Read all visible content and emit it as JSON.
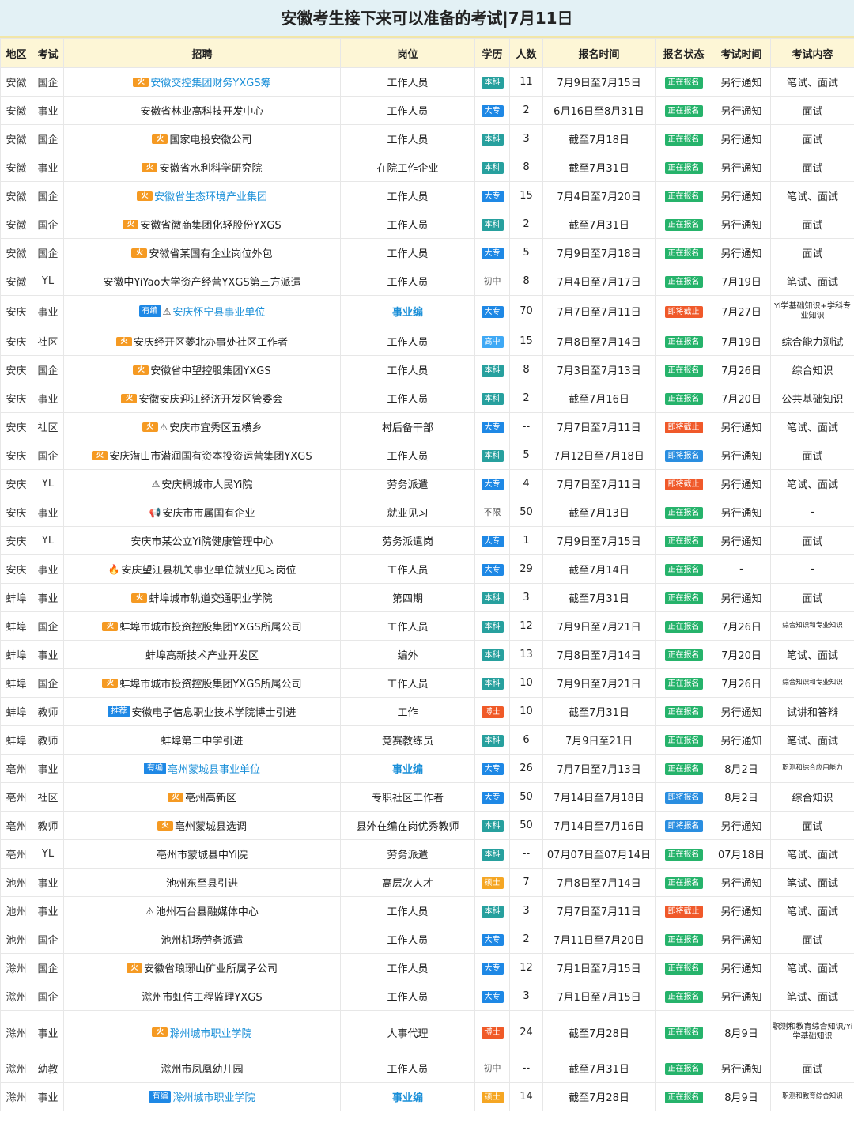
{
  "title": "安徽考生接下来可以准备的考试|7月11日",
  "headers": [
    "地区",
    "考试",
    "招聘",
    "岗位",
    "学历",
    "人数",
    "报名时间",
    "报名状态",
    "考试时间",
    "考试内容"
  ],
  "rows": [
    {
      "region": "安徽",
      "type": "国企",
      "icon": "fire",
      "tag": "",
      "rec": "安徽交控集团财务YXGS筹",
      "link": true,
      "pos": "工作人员",
      "posStrong": false,
      "edu": "本科",
      "num": "11",
      "time": "7月9日至7月15日",
      "status": "正在报名",
      "st": "open",
      "exam": "另行通知",
      "content": "笔试、面试",
      "cstyle": ""
    },
    {
      "region": "安徽",
      "type": "事业",
      "icon": "",
      "tag": "",
      "rec": "安徽省林业高科技开发中心",
      "link": false,
      "pos": "工作人员",
      "posStrong": false,
      "edu": "大专",
      "num": "2",
      "time": "6月16日至8月31日",
      "status": "正在报名",
      "st": "open",
      "exam": "另行通知",
      "content": "面试",
      "cstyle": ""
    },
    {
      "region": "安徽",
      "type": "国企",
      "icon": "fire",
      "tag": "",
      "rec": "国家电投安徽公司",
      "link": false,
      "pos": "工作人员",
      "posStrong": false,
      "edu": "本科",
      "num": "3",
      "time": "截至7月18日",
      "status": "正在报名",
      "st": "open",
      "exam": "另行通知",
      "content": "面试",
      "cstyle": ""
    },
    {
      "region": "安徽",
      "type": "事业",
      "icon": "fire",
      "tag": "",
      "rec": "安徽省水利科学研究院",
      "link": false,
      "pos": "在院工作企业",
      "posStrong": false,
      "edu": "本科",
      "num": "8",
      "time": "截至7月31日",
      "status": "正在报名",
      "st": "open",
      "exam": "另行通知",
      "content": "面试",
      "cstyle": ""
    },
    {
      "region": "安徽",
      "type": "国企",
      "icon": "fire",
      "tag": "",
      "rec": "安徽省生态环境产业集团",
      "link": true,
      "pos": "工作人员",
      "posStrong": false,
      "edu": "大专",
      "num": "15",
      "time": "7月4日至7月20日",
      "status": "正在报名",
      "st": "open",
      "exam": "另行通知",
      "content": "笔试、面试",
      "cstyle": ""
    },
    {
      "region": "安徽",
      "type": "国企",
      "icon": "fire",
      "tag": "",
      "rec": "安徽省徽商集团化轻股份YXGS",
      "link": false,
      "pos": "工作人员",
      "posStrong": false,
      "edu": "本科",
      "num": "2",
      "time": "截至7月31日",
      "status": "正在报名",
      "st": "open",
      "exam": "另行通知",
      "content": "面试",
      "cstyle": ""
    },
    {
      "region": "安徽",
      "type": "国企",
      "icon": "fire",
      "tag": "",
      "rec": "安徽省某国有企业岗位外包",
      "link": false,
      "pos": "工作人员",
      "posStrong": false,
      "edu": "大专",
      "num": "5",
      "time": "7月9日至7月18日",
      "status": "正在报名",
      "st": "open",
      "exam": "另行通知",
      "content": "面试",
      "cstyle": ""
    },
    {
      "region": "安徽",
      "type": "YL",
      "icon": "",
      "tag": "",
      "rec": "安徽中YiYao大学资产经营YXGS第三方派遣",
      "link": false,
      "pos": "工作人员",
      "posStrong": false,
      "edu": "初中",
      "num": "8",
      "time": "7月4日至7月17日",
      "status": "正在报名",
      "st": "open",
      "exam": "7月19日",
      "content": "笔试、面试",
      "cstyle": ""
    },
    {
      "region": "安庆",
      "type": "事业",
      "icon": "warn",
      "tag": "有编",
      "rec": "安庆怀宁县事业单位",
      "link": true,
      "pos": "事业编",
      "posStrong": true,
      "edu": "大专",
      "num": "70",
      "time": "7月7日至7月11日",
      "status": "即将截止",
      "st": "closing",
      "exam": "7月27日",
      "content": "Yi学基础知识+学科专业知识",
      "cstyle": "small",
      "tall": "tall"
    },
    {
      "region": "安庆",
      "type": "社区",
      "icon": "fire",
      "tag": "",
      "rec": "安庆经开区菱北办事处社区工作者",
      "link": false,
      "pos": "工作人员",
      "posStrong": false,
      "edu": "高中",
      "num": "15",
      "time": "7月8日至7月14日",
      "status": "正在报名",
      "st": "open",
      "exam": "7月19日",
      "content": "综合能力测试",
      "cstyle": ""
    },
    {
      "region": "安庆",
      "type": "国企",
      "icon": "fire",
      "tag": "",
      "rec": "安徽省中望控股集团YXGS",
      "link": false,
      "pos": "工作人员",
      "posStrong": false,
      "edu": "本科",
      "num": "8",
      "time": "7月3日至7月13日",
      "status": "正在报名",
      "st": "open",
      "exam": "7月26日",
      "content": "综合知识",
      "cstyle": ""
    },
    {
      "region": "安庆",
      "type": "事业",
      "icon": "fire",
      "tag": "",
      "rec": "安徽安庆迎江经济开发区管委会",
      "link": false,
      "pos": "工作人员",
      "posStrong": false,
      "edu": "本科",
      "num": "2",
      "time": "截至7月16日",
      "status": "正在报名",
      "st": "open",
      "exam": "7月20日",
      "content": "公共基础知识",
      "cstyle": ""
    },
    {
      "region": "安庆",
      "type": "社区",
      "icon": "firewarn",
      "tag": "",
      "rec": "安庆市宜秀区五横乡",
      "link": false,
      "pos": "村后备干部",
      "posStrong": false,
      "edu": "大专",
      "num": "--",
      "time": "7月7日至7月11日",
      "status": "即将截止",
      "st": "closing",
      "exam": "另行通知",
      "content": "笔试、面试",
      "cstyle": ""
    },
    {
      "region": "安庆",
      "type": "国企",
      "icon": "fire",
      "tag": "",
      "rec": "安庆潜山市潜润国有资本投资运营集团YXGS",
      "link": false,
      "pos": "工作人员",
      "posStrong": false,
      "edu": "本科",
      "num": "5",
      "time": "7月12日至7月18日",
      "status": "即将报名",
      "st": "soon",
      "exam": "另行通知",
      "content": "面试",
      "cstyle": ""
    },
    {
      "region": "安庆",
      "type": "YL",
      "icon": "warn",
      "tag": "",
      "rec": "安庆桐城市人民Yi院",
      "link": false,
      "pos": "劳务派遣",
      "posStrong": false,
      "edu": "大专",
      "num": "4",
      "time": "7月7日至7月11日",
      "status": "即将截止",
      "st": "closing",
      "exam": "另行通知",
      "content": "笔试、面试",
      "cstyle": ""
    },
    {
      "region": "安庆",
      "type": "事业",
      "icon": "speaker",
      "tag": "",
      "rec": "安庆市市属国有企业",
      "link": false,
      "pos": "就业见习",
      "posStrong": false,
      "edu": "不限",
      "num": "50",
      "time": "截至7月13日",
      "status": "正在报名",
      "st": "open",
      "exam": "另行通知",
      "content": "-",
      "cstyle": ""
    },
    {
      "region": "安庆",
      "type": "YL",
      "icon": "",
      "tag": "",
      "rec": "安庆市某公立Yi院健康管理中心",
      "link": false,
      "pos": "劳务派遣岗",
      "posStrong": false,
      "edu": "大专",
      "num": "1",
      "time": "7月9日至7月15日",
      "status": "正在报名",
      "st": "open",
      "exam": "另行通知",
      "content": "面试",
      "cstyle": ""
    },
    {
      "region": "安庆",
      "type": "事业",
      "icon": "drop",
      "tag": "",
      "rec": "安庆望江县机关事业单位就业见习岗位",
      "link": false,
      "pos": "工作人员",
      "posStrong": false,
      "edu": "大专",
      "num": "29",
      "time": "截至7月14日",
      "status": "正在报名",
      "st": "open",
      "exam": "-",
      "content": "-",
      "cstyle": ""
    },
    {
      "region": "蚌埠",
      "type": "事业",
      "icon": "fire",
      "tag": "",
      "rec": "蚌埠城市轨道交通职业学院",
      "link": false,
      "pos": "第四期",
      "posStrong": false,
      "edu": "本科",
      "num": "3",
      "time": "截至7月31日",
      "status": "正在报名",
      "st": "open",
      "exam": "另行通知",
      "content": "面试",
      "cstyle": ""
    },
    {
      "region": "蚌埠",
      "type": "国企",
      "icon": "fire",
      "tag": "",
      "rec": "蚌埠市城市投资控股集团YXGS所属公司",
      "link": false,
      "pos": "工作人员",
      "posStrong": false,
      "edu": "本科",
      "num": "12",
      "time": "7月9日至7月21日",
      "status": "正在报名",
      "st": "open",
      "exam": "7月26日",
      "content": "综合知识和专业知识",
      "cstyle": "tiny"
    },
    {
      "region": "蚌埠",
      "type": "事业",
      "icon": "",
      "tag": "",
      "rec": "蚌埠高新技术产业开发区",
      "link": false,
      "pos": "编外",
      "posStrong": false,
      "edu": "本科",
      "num": "13",
      "time": "7月8日至7月14日",
      "status": "正在报名",
      "st": "open",
      "exam": "7月20日",
      "content": "笔试、面试",
      "cstyle": ""
    },
    {
      "region": "蚌埠",
      "type": "国企",
      "icon": "fire",
      "tag": "",
      "rec": "蚌埠市城市投资控股集团YXGS所属公司",
      "link": false,
      "pos": "工作人员",
      "posStrong": false,
      "edu": "本科",
      "num": "10",
      "time": "7月9日至7月21日",
      "status": "正在报名",
      "st": "open",
      "exam": "7月26日",
      "content": "综合知识和专业知识",
      "cstyle": "tiny"
    },
    {
      "region": "蚌埠",
      "type": "教师",
      "icon": "",
      "tag": "推荐",
      "rec": "安徽电子信息职业技术学院博士引进",
      "link": false,
      "pos": "工作",
      "posStrong": false,
      "edu": "博士",
      "num": "10",
      "time": "截至7月31日",
      "status": "正在报名",
      "st": "open",
      "exam": "另行通知",
      "content": "试讲和答辩",
      "cstyle": ""
    },
    {
      "region": "蚌埠",
      "type": "教师",
      "icon": "",
      "tag": "",
      "rec": "蚌埠第二中学引进",
      "link": false,
      "pos": "竞赛教练员",
      "posStrong": false,
      "edu": "本科",
      "num": "6",
      "time": "7月9日至21日",
      "status": "正在报名",
      "st": "open",
      "exam": "另行通知",
      "content": "笔试、面试",
      "cstyle": ""
    },
    {
      "region": "亳州",
      "type": "事业",
      "icon": "",
      "tag": "有编",
      "rec": "亳州蒙城县事业单位",
      "link": true,
      "pos": "事业编",
      "posStrong": true,
      "edu": "大专",
      "num": "26",
      "time": "7月7日至7月13日",
      "status": "正在报名",
      "st": "open",
      "exam": "8月2日",
      "content": "职测和综合应用能力",
      "cstyle": "tiny"
    },
    {
      "region": "亳州",
      "type": "社区",
      "icon": "fire",
      "tag": "",
      "rec": "亳州高新区",
      "link": false,
      "pos": "专职社区工作者",
      "posStrong": false,
      "edu": "大专",
      "num": "50",
      "time": "7月14日至7月18日",
      "status": "即将报名",
      "st": "soon",
      "exam": "8月2日",
      "content": "综合知识",
      "cstyle": ""
    },
    {
      "region": "亳州",
      "type": "教师",
      "icon": "fire",
      "tag": "",
      "rec": "亳州蒙城县选调",
      "link": false,
      "pos": "县外在编在岗优秀教师",
      "posStrong": false,
      "edu": "本科",
      "num": "50",
      "time": "7月14日至7月16日",
      "status": "即将报名",
      "st": "soon",
      "exam": "另行通知",
      "content": "面试",
      "cstyle": ""
    },
    {
      "region": "亳州",
      "type": "YL",
      "icon": "",
      "tag": "",
      "rec": "亳州市蒙城县中Yi院",
      "link": false,
      "pos": "劳务派遣",
      "posStrong": false,
      "edu": "本科",
      "num": "--",
      "time": "07月07日至07月14日",
      "status": "正在报名",
      "st": "open",
      "exam": "07月18日",
      "content": "笔试、面试",
      "cstyle": ""
    },
    {
      "region": "池州",
      "type": "事业",
      "icon": "",
      "tag": "",
      "rec": "池州东至县引进",
      "link": false,
      "pos": "高层次人才",
      "posStrong": false,
      "edu": "硕士",
      "num": "7",
      "time": "7月8日至7月14日",
      "status": "正在报名",
      "st": "open",
      "exam": "另行通知",
      "content": "笔试、面试",
      "cstyle": ""
    },
    {
      "region": "池州",
      "type": "事业",
      "icon": "warn",
      "tag": "",
      "rec": "池州石台县融媒体中心",
      "link": false,
      "pos": "工作人员",
      "posStrong": false,
      "edu": "本科",
      "num": "3",
      "time": "7月7日至7月11日",
      "status": "即将截止",
      "st": "closing",
      "exam": "另行通知",
      "content": "笔试、面试",
      "cstyle": ""
    },
    {
      "region": "池州",
      "type": "国企",
      "icon": "",
      "tag": "",
      "rec": "池州机场劳务派遣",
      "link": false,
      "pos": "工作人员",
      "posStrong": false,
      "edu": "大专",
      "num": "2",
      "time": "7月11日至7月20日",
      "status": "正在报名",
      "st": "open",
      "exam": "另行通知",
      "content": "面试",
      "cstyle": ""
    },
    {
      "region": "滁州",
      "type": "国企",
      "icon": "fire",
      "tag": "",
      "rec": "安徽省琅琊山矿业所属子公司",
      "link": false,
      "pos": "工作人员",
      "posStrong": false,
      "edu": "大专",
      "num": "12",
      "time": "7月1日至7月15日",
      "status": "正在报名",
      "st": "open",
      "exam": "另行通知",
      "content": "笔试、面试",
      "cstyle": ""
    },
    {
      "region": "滁州",
      "type": "国企",
      "icon": "",
      "tag": "",
      "rec": "滁州市虹信工程监理YXGS",
      "link": false,
      "pos": "工作人员",
      "posStrong": false,
      "edu": "大专",
      "num": "3",
      "time": "7月1日至7月15日",
      "status": "正在报名",
      "st": "open",
      "exam": "另行通知",
      "content": "笔试、面试",
      "cstyle": ""
    },
    {
      "region": "滁州",
      "type": "事业",
      "icon": "fire",
      "tag": "",
      "rec": "滁州城市职业学院",
      "link": true,
      "pos": "人事代理",
      "posStrong": false,
      "edu": "博士",
      "num": "24",
      "time": "截至7月28日",
      "status": "正在报名",
      "st": "open",
      "exam": "8月9日",
      "content": "职测和教育综合知识/Yi学基础知识",
      "cstyle": "small",
      "tall": "tall3"
    },
    {
      "region": "滁州",
      "type": "幼教",
      "icon": "",
      "tag": "",
      "rec": "滁州市凤凰幼儿园",
      "link": false,
      "pos": "工作人员",
      "posStrong": false,
      "edu": "初中",
      "num": "--",
      "time": "截至7月31日",
      "status": "正在报名",
      "st": "open",
      "exam": "另行通知",
      "content": "面试",
      "cstyle": ""
    },
    {
      "region": "滁州",
      "type": "事业",
      "icon": "",
      "tag": "有编",
      "rec": "滁州城市职业学院",
      "link": true,
      "pos": "事业编",
      "posStrong": true,
      "edu": "硕士",
      "num": "14",
      "time": "截至7月28日",
      "status": "正在报名",
      "st": "open",
      "exam": "8月9日",
      "content": "职测和教育综合知识",
      "cstyle": "tiny"
    }
  ]
}
